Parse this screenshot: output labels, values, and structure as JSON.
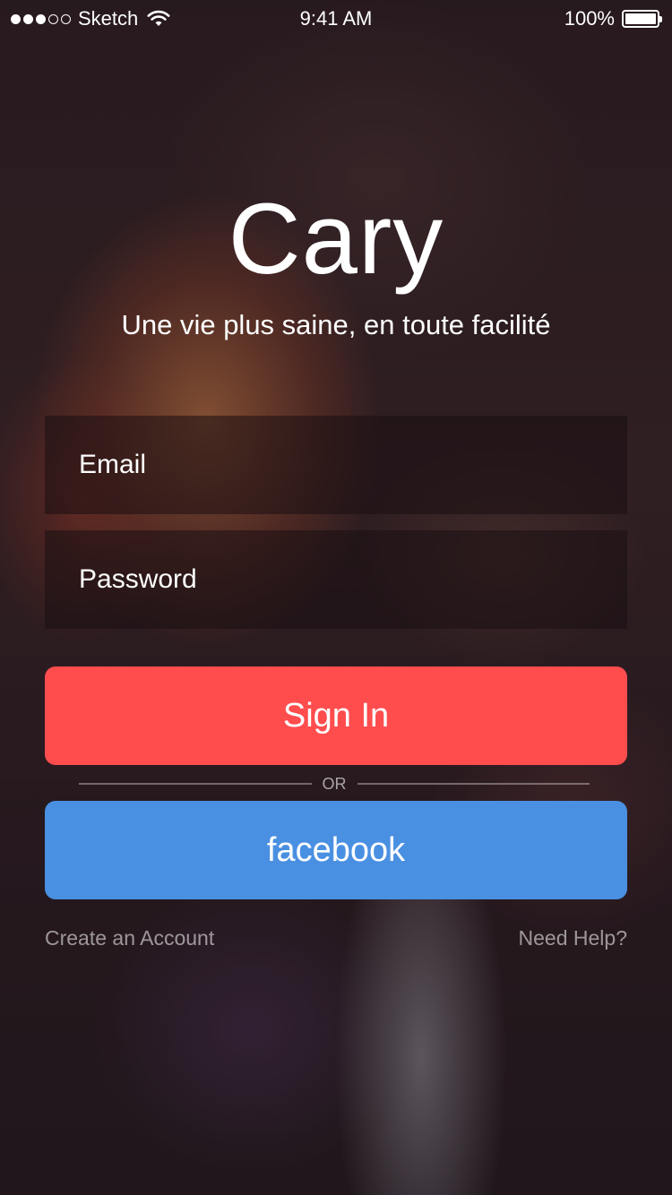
{
  "status_bar": {
    "signal_dots_filled": 3,
    "signal_dots_total": 5,
    "carrier": "Sketch",
    "time": "9:41 AM",
    "battery": "100%"
  },
  "app": {
    "logo": "Cary",
    "tagline": "Une vie plus saine, en toute facilité"
  },
  "form": {
    "email_placeholder": "Email",
    "password_placeholder": "Password",
    "signin_label": "Sign In",
    "or_label": "OR",
    "facebook_label": "facebook"
  },
  "links": {
    "create_account": "Create an Account",
    "need_help": "Need Help?"
  },
  "colors": {
    "signin": "#ff4d4e",
    "facebook": "#4a90e2"
  }
}
